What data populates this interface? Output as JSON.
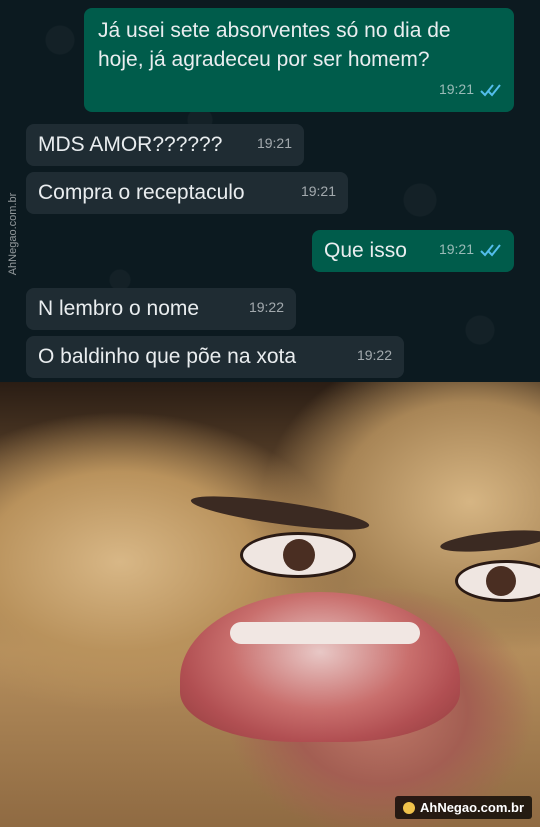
{
  "chat": {
    "messages": [
      {
        "direction": "outgoing",
        "text": "Já usei sete absorventes só no dia de hoje, já agradeceu por ser homem?",
        "time": "19:21",
        "status": "read-double-check"
      },
      {
        "direction": "incoming",
        "text": "MDS AMOR??????",
        "time": "19:21"
      },
      {
        "direction": "incoming",
        "text": "Compra o receptaculo",
        "time": "19:21"
      },
      {
        "direction": "outgoing",
        "text": "Que isso",
        "time": "19:21",
        "status": "read-double-check"
      },
      {
        "direction": "incoming",
        "text": "N lembro o nome",
        "time": "19:22"
      },
      {
        "direction": "incoming",
        "text": "O baldinho que põe na xota",
        "time": "19:22"
      }
    ],
    "side_watermark": "AhNegao.com.br"
  },
  "photo": {
    "description_icon": "distorted-face-meme-image"
  },
  "footer": {
    "site_badge": "AhNegao.com.br"
  },
  "colors": {
    "chat_bg": "#0c1a20",
    "outgoing_bubble": "#005c4b",
    "incoming_bubble": "#1f2c33",
    "read_ticks": "#53bdeb"
  }
}
